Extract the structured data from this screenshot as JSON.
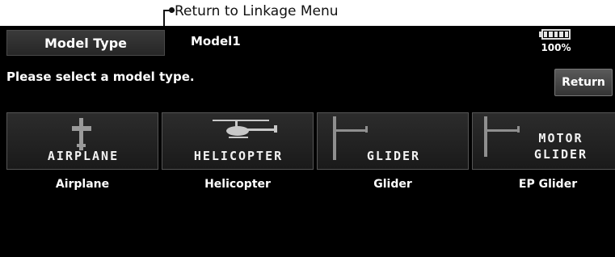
{
  "callout": {
    "text": "Return to Linkage Menu"
  },
  "header": {
    "title": "Model Type",
    "model_name": "Model1"
  },
  "battery": {
    "percent_text": "100%",
    "level": 1.0
  },
  "prompt": "Please select a model type.",
  "return_button": {
    "label": "Return"
  },
  "model_types": [
    {
      "id": "airplane",
      "art_text": "AIRPLANE",
      "art_text_line2": "",
      "label": "Airplane",
      "icon": "airplane-icon"
    },
    {
      "id": "helicopter",
      "art_text": "HELICOPTER",
      "art_text_line2": "",
      "label": "Helicopter",
      "icon": "helicopter-icon"
    },
    {
      "id": "glider",
      "art_text": "GLIDER",
      "art_text_line2": "",
      "label": "Glider",
      "icon": "glider-icon"
    },
    {
      "id": "ep-glider",
      "art_text": "MOTOR",
      "art_text_line2": "GLIDER",
      "label": "EP Glider",
      "icon": "motor-glider-icon"
    }
  ],
  "colors": {
    "screen_bg": "#000000",
    "button_border": "#555555",
    "text": "#ffffff"
  }
}
